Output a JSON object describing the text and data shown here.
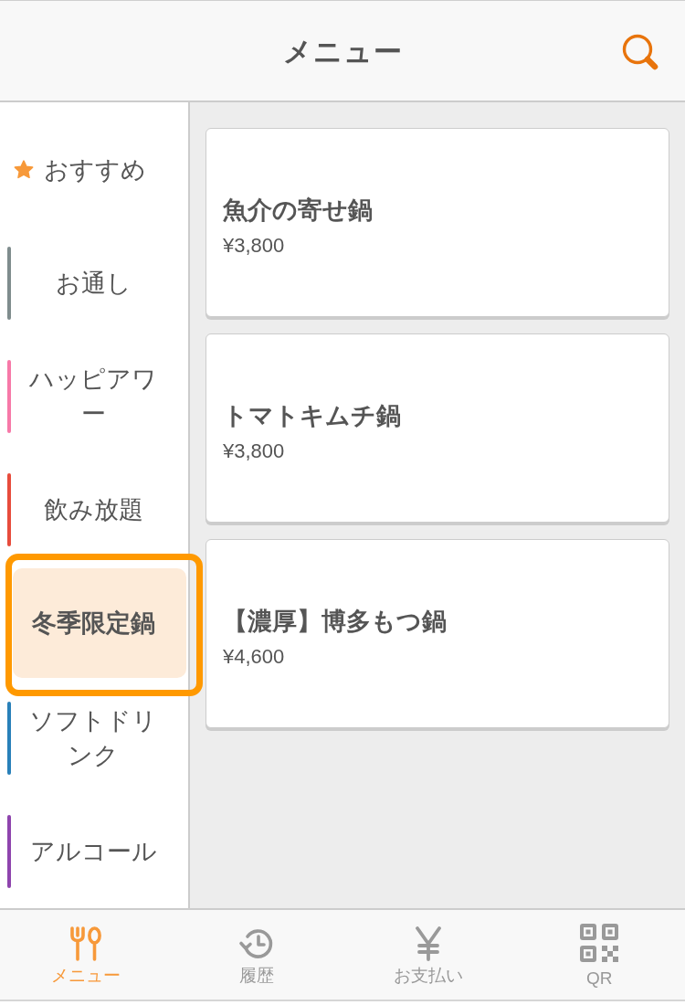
{
  "header": {
    "title": "メニュー"
  },
  "categories": [
    {
      "kind": "featured",
      "label": "おすすめ",
      "selected": false,
      "highlighted": false
    },
    {
      "kind": "category",
      "label": "お通し",
      "color": "#7f8c8d",
      "selected": false,
      "highlighted": false
    },
    {
      "kind": "category",
      "label": "ハッピアワー",
      "color": "#f779a8",
      "selected": false,
      "highlighted": false
    },
    {
      "kind": "category",
      "label": "飲み放題",
      "color": "#e74c3c",
      "selected": false,
      "highlighted": false
    },
    {
      "kind": "category",
      "label": "冬季限定鍋",
      "selected": true,
      "highlighted": true
    },
    {
      "kind": "category",
      "label": "ソフトドリンク",
      "color": "#2980b9",
      "selected": false,
      "highlighted": false
    },
    {
      "kind": "category",
      "label": "アルコール",
      "color": "#8e44ad",
      "selected": false,
      "highlighted": false
    }
  ],
  "menu_items": [
    {
      "name": "魚介の寄せ鍋",
      "price": "¥3,800"
    },
    {
      "name": "トマトキムチ鍋",
      "price": "¥3,800"
    },
    {
      "name": "【濃厚】博多もつ鍋",
      "price": "¥4,600"
    }
  ],
  "tabs": [
    {
      "kind": "menu",
      "label": "メニュー",
      "selected": true
    },
    {
      "kind": "history",
      "label": "履歴",
      "selected": false
    },
    {
      "kind": "payment",
      "label": "お支払い",
      "selected": false
    },
    {
      "kind": "qr",
      "label": "QR",
      "selected": false
    }
  ]
}
